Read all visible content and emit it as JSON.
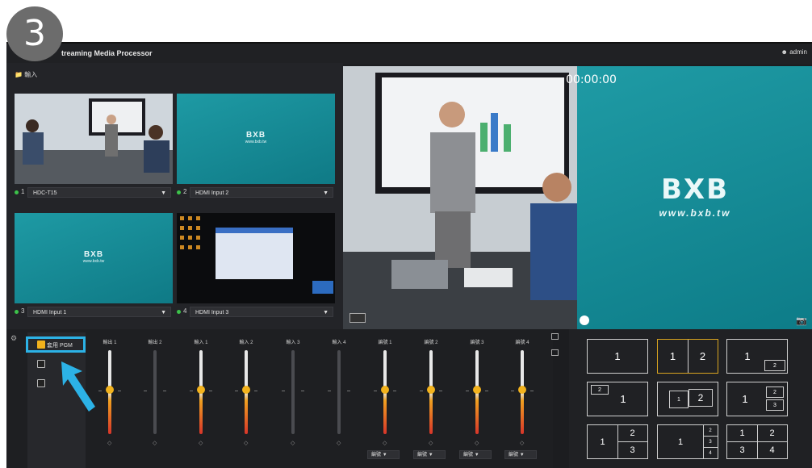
{
  "step_number": "3",
  "app": {
    "title": "treaming Media Processor",
    "user": "admin",
    "input_header": "輸入"
  },
  "inputs": [
    {
      "index": "1",
      "name": "HDC-T15"
    },
    {
      "index": "2",
      "name": "HDMI Input 2"
    },
    {
      "index": "3",
      "name": "HDMI Input 1"
    },
    {
      "index": "4",
      "name": "HDMI Input 3"
    }
  ],
  "logo": {
    "brand": "BXB",
    "url": "www.bxb.tw"
  },
  "program": {
    "timer": "00:00:00"
  },
  "mixer": {
    "checkbox_label": "套用 PGM",
    "faders": [
      "輸出 1",
      "輸出 2",
      "輸入 1",
      "輸入 2",
      "輸入 3",
      "輸入 4",
      "編號 1",
      "編號 2",
      "編號 3",
      "編號 4"
    ],
    "fader_select": "編號"
  },
  "layouts": [
    {
      "labels": [
        "1"
      ]
    },
    {
      "labels": [
        "1",
        "2"
      ]
    },
    {
      "labels": [
        "1",
        "2"
      ]
    },
    {
      "labels": [
        "2",
        "1"
      ]
    },
    {
      "labels": [
        "1",
        "2"
      ]
    },
    {
      "labels": [
        "1",
        "2",
        "3"
      ]
    },
    {
      "labels": [
        "1",
        "2",
        "3"
      ]
    },
    {
      "labels": [
        "1",
        "2",
        "3",
        "4"
      ]
    },
    {
      "labels": [
        "1",
        "2",
        "3",
        "4"
      ]
    }
  ],
  "colors": {
    "accent": "#f2b21c",
    "highlight": "#2cb2e6",
    "teal": "#138894",
    "active_dot": "#3cc24a"
  }
}
